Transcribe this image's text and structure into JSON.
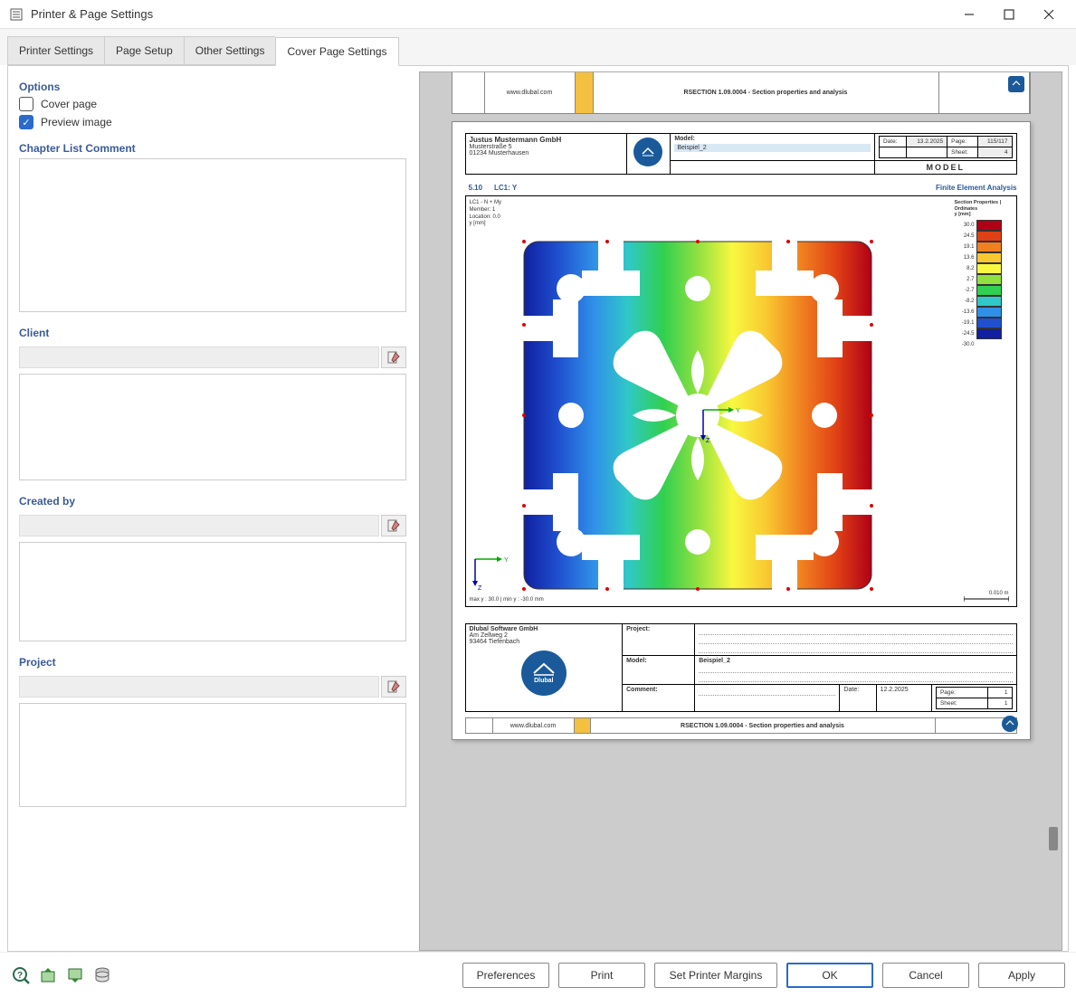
{
  "window": {
    "title": "Printer & Page Settings"
  },
  "tabs": {
    "printer_settings": "Printer Settings",
    "page_setup": "Page Setup",
    "other_settings": "Other Settings",
    "cover_page_settings": "Cover Page Settings"
  },
  "options": {
    "heading": "Options",
    "cover_page_label": "Cover page",
    "cover_page_checked": false,
    "preview_image_label": "Preview image",
    "preview_image_checked": true
  },
  "chapter_list": {
    "heading": "Chapter List Comment",
    "value": ""
  },
  "client": {
    "heading": "Client",
    "name": "",
    "details": ""
  },
  "created_by": {
    "heading": "Created by",
    "name": "",
    "details": ""
  },
  "project": {
    "heading": "Project",
    "name": "",
    "details": ""
  },
  "preview": {
    "top_strip": {
      "url": "www.dlubal.com",
      "product": "RSECTION 1.09.0004 - Section properties and analysis"
    },
    "header": {
      "company": "Justus Mustermann GmbH",
      "address1": "Musterstraße 5",
      "address2": "01234 Musterhausen",
      "model_label": "Model:",
      "model_value": "Beispiel_2",
      "date_label": "Date:",
      "date_value": "13.2.2025",
      "page_label": "Page:",
      "page_value": "115/117",
      "sheet_label": "Sheet:",
      "sheet_value": "4",
      "model_title": "MODEL"
    },
    "section": {
      "number": "5.10",
      "title": "LC1: Y",
      "analysis_label": "Finite Element Analysis"
    },
    "fea_info": {
      "line1": "LC1 - N + My",
      "line2": "Member: 1",
      "line3": "Location: 0.0",
      "line4": "y [mm]"
    },
    "legend": {
      "title1": "Section Properties |",
      "title2": "Ordinates",
      "title3": "y [mm]",
      "values": [
        "30.0",
        "24.5",
        "19.1",
        "13.6",
        "8.2",
        "2.7",
        "-2.7",
        "-8.2",
        "-13.6",
        "-19.1",
        "-24.5",
        "-30.0"
      ],
      "colors": [
        "#b00015",
        "#e04015",
        "#f08020",
        "#f8c830",
        "#f8f840",
        "#90e040",
        "#30d050",
        "#30c8c8",
        "#3090e8",
        "#2050d0",
        "#1020a0"
      ]
    },
    "scale": {
      "label": "0.010 m"
    },
    "minmax": "max y : 30.0 | min y : -30.0 mm",
    "axes": {
      "y": "Y",
      "z": "Z"
    },
    "footer": {
      "company": "Dlubal Software GmbH",
      "address1": "Am Zellweg 2",
      "address2": "93464 Tiefenbach",
      "project_label": "Project:",
      "model_label": "Model:",
      "model_value": "Beispiel_2",
      "comment_label": "Comment:",
      "date_label": "Date:",
      "date_value": "12.2.2025",
      "page_label": "Page:",
      "page_value": "1",
      "sheet_label": "Sheet:",
      "sheet_value": "1"
    },
    "bottom_strip": {
      "url": "www.dlubal.com",
      "product": "RSECTION 1.09.0004 - Section properties and analysis"
    }
  },
  "buttons": {
    "preferences": "Preferences",
    "print": "Print",
    "set_margins": "Set Printer Margins",
    "ok": "OK",
    "cancel": "Cancel",
    "apply": "Apply"
  },
  "chart_data": {
    "type": "heatmap",
    "title": "LC1: Y — Finite Element Analysis",
    "quantity": "Ordinate y [mm]",
    "colorbar_values": [
      30.0,
      24.5,
      19.1,
      13.6,
      8.2,
      2.7,
      -2.7,
      -8.2,
      -13.6,
      -19.1,
      -24.5,
      -30.0
    ],
    "colorbar_colors": [
      "#b00015",
      "#e04015",
      "#f08020",
      "#f8c830",
      "#f8f840",
      "#90e040",
      "#30d050",
      "#30c8c8",
      "#3090e8",
      "#2050d0",
      "#1020a0"
    ],
    "range": {
      "min": -30.0,
      "max": 30.0,
      "units": "mm"
    },
    "scale_bar_m": 0.01,
    "load_case": "LC1 - N + My",
    "member": 1,
    "location": 0.0
  }
}
